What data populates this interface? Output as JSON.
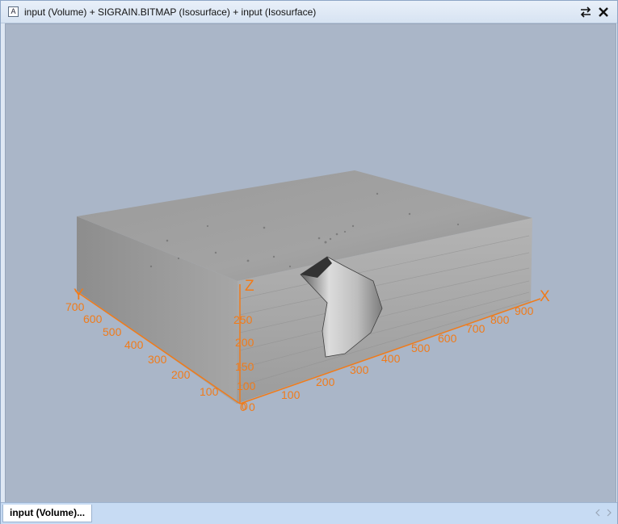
{
  "window": {
    "title": "input (Volume) + SIGRAIN.BITMAP (Isosurface) + input (Isosurface)",
    "title_icon": "A"
  },
  "toolbar": {
    "swap_icon": "swap-arrows-icon",
    "close_icon": "close-icon"
  },
  "axes": {
    "x_label": "X",
    "y_label": "Y",
    "z_label": "Z",
    "x_ticks": [
      "0",
      "100",
      "200",
      "300",
      "400",
      "500",
      "600",
      "700",
      "800",
      "900"
    ],
    "y_ticks": [
      "0",
      "100",
      "200",
      "300",
      "400",
      "500",
      "600",
      "700"
    ],
    "z_ticks": [
      "0",
      "100",
      "150",
      "200",
      "250"
    ],
    "color": "#f07b1a"
  },
  "tabs": [
    {
      "label": "input (Volume)..."
    }
  ],
  "colors": {
    "viewport_bg": "#aab6c8",
    "titlebar_bg": "#dfe8f4",
    "tabbar_bg": "#c7dbf3"
  }
}
